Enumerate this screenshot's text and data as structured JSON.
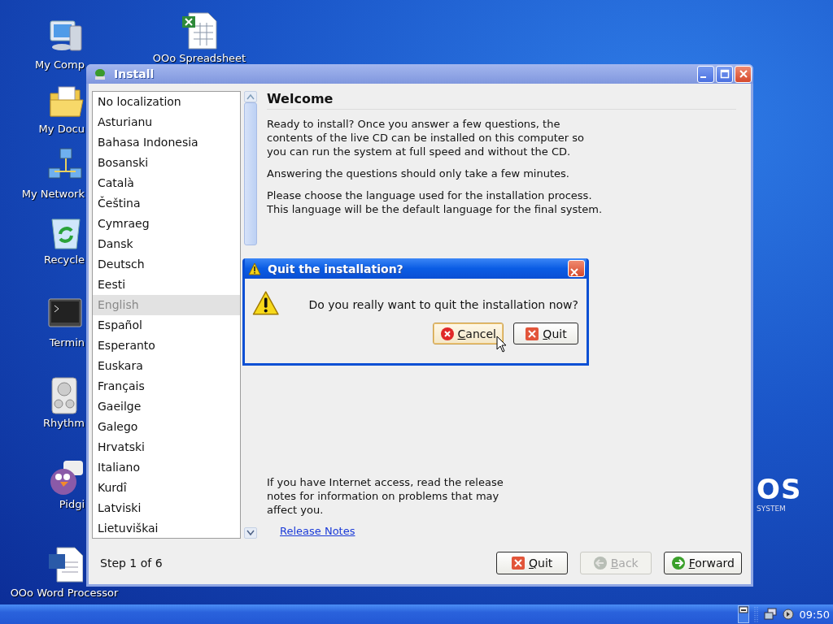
{
  "desktop": {
    "icons": [
      {
        "label": "My Comp",
        "kind": "computer"
      },
      {
        "label": "OOo Spreadsheet",
        "kind": "spreadsheet"
      },
      {
        "label": "My Docu",
        "kind": "documents"
      },
      {
        "label": "My Network",
        "kind": "network"
      },
      {
        "label": "Recycle",
        "kind": "recycle"
      },
      {
        "label": "Termin",
        "kind": "terminal"
      },
      {
        "label": "Rhythm",
        "kind": "music"
      },
      {
        "label": "Pidgi",
        "kind": "chat"
      },
      {
        "label": "OOo Word Processor",
        "kind": "writer"
      }
    ],
    "logo": {
      "mark": "OS",
      "caption": "SYSTEM"
    }
  },
  "install_window": {
    "title": "Install",
    "languages": [
      {
        "label": "No localization",
        "selected": false
      },
      {
        "label": "Asturianu",
        "selected": false
      },
      {
        "label": "Bahasa Indonesia",
        "selected": false
      },
      {
        "label": "Bosanski",
        "selected": false
      },
      {
        "label": "Català",
        "selected": false
      },
      {
        "label": "Čeština",
        "selected": false
      },
      {
        "label": "Cymraeg",
        "selected": false
      },
      {
        "label": "Dansk",
        "selected": false
      },
      {
        "label": "Deutsch",
        "selected": false
      },
      {
        "label": "Eesti",
        "selected": false
      },
      {
        "label": "English",
        "selected": true
      },
      {
        "label": "Español",
        "selected": false
      },
      {
        "label": "Esperanto",
        "selected": false
      },
      {
        "label": "Euskara",
        "selected": false
      },
      {
        "label": "Français",
        "selected": false
      },
      {
        "label": "Gaeilge",
        "selected": false
      },
      {
        "label": "Galego",
        "selected": false
      },
      {
        "label": "Hrvatski",
        "selected": false
      },
      {
        "label": "Italiano",
        "selected": false
      },
      {
        "label": "Kurdî",
        "selected": false
      },
      {
        "label": "Latviski",
        "selected": false
      },
      {
        "label": "Lietuviškai",
        "selected": false
      }
    ],
    "heading": "Welcome",
    "paragraphs": [
      "Ready to install? Once you answer a few questions, the contents of the live CD can be installed on this computer so you can run the system at full speed and without the CD.",
      "Answering the questions should only take a few minutes.",
      "Please choose the language used for the installation process. This language will be the default language for the final system."
    ],
    "release_text": "If you have Internet access, read the release notes for information on problems that may affect you.",
    "release_link": "Release Notes",
    "step": "Step 1 of 6",
    "buttons": [
      {
        "label": "Quit",
        "kind": "quit",
        "disabled": false
      },
      {
        "label": "Back",
        "kind": "back",
        "disabled": true
      },
      {
        "label": "Forward",
        "kind": "forward",
        "disabled": false
      }
    ]
  },
  "dialog": {
    "title": "Quit the installation?",
    "message": "Do you really want to quit the installation now?",
    "buttons": [
      {
        "label": "Cancel",
        "kind": "cancel",
        "focused": true
      },
      {
        "label": "Quit",
        "kind": "quit",
        "focused": false
      }
    ]
  },
  "taskbar": {
    "clock": "09:50"
  }
}
